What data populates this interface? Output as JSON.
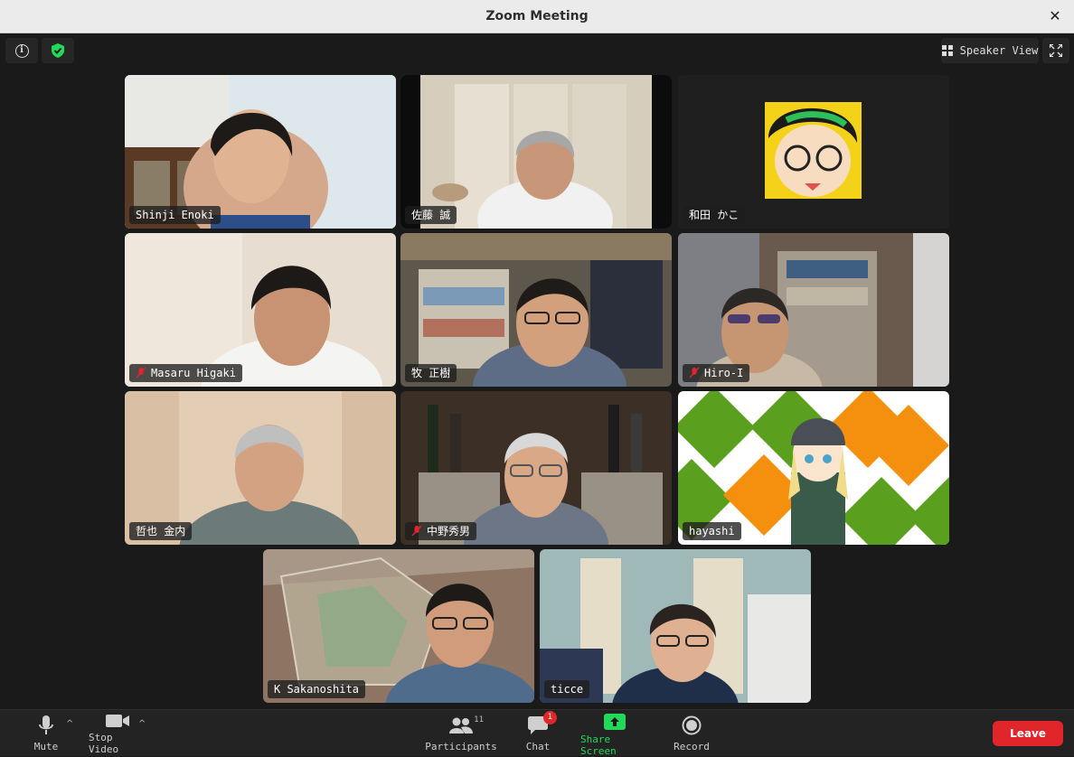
{
  "window": {
    "title": "Zoom Meeting",
    "close_glyph": "✕"
  },
  "top_controls": {
    "view_label": "Speaker View"
  },
  "participants": [
    {
      "name": "Shinji Enoki",
      "muted": false,
      "active": false
    },
    {
      "name": "佐藤 誠",
      "muted": false,
      "active": true
    },
    {
      "name": "和田 かこ",
      "muted": false,
      "active": false
    },
    {
      "name": "Masaru Higaki",
      "muted": true,
      "active": false
    },
    {
      "name": "牧 正樹",
      "muted": false,
      "active": false
    },
    {
      "name": "Hiro-I",
      "muted": true,
      "active": false
    },
    {
      "name": "哲也 金内",
      "muted": false,
      "active": false
    },
    {
      "name": "中野秀男",
      "muted": true,
      "active": false
    },
    {
      "name": "hayashi",
      "muted": false,
      "active": false
    },
    {
      "name": "K Sakanoshita",
      "muted": false,
      "active": false
    },
    {
      "name": "ticce",
      "muted": false,
      "active": false
    }
  ],
  "toolbar": {
    "mute_label": "Mute",
    "video_label": "Stop Video",
    "participants_label": "Participants",
    "participants_count": "11",
    "chat_label": "Chat",
    "chat_badge": "1",
    "share_label": "Share Screen",
    "record_label": "Record",
    "leave_label": "Leave"
  },
  "colors": {
    "accent_green": "#23d959",
    "leave_red": "#e0252b",
    "background": "#1a1a1a"
  },
  "icons": [
    "info-icon",
    "shield-check-icon",
    "grid-view-icon",
    "fullscreen-icon",
    "microphone-icon",
    "video-camera-icon",
    "participants-icon",
    "chat-bubble-icon",
    "share-screen-icon",
    "record-icon",
    "muted-mic-icon"
  ]
}
